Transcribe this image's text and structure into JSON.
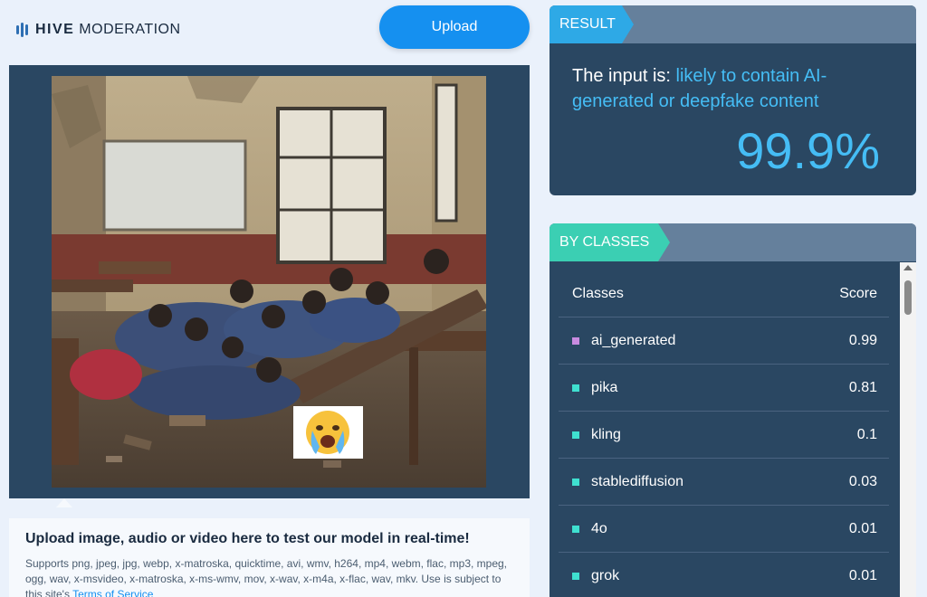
{
  "header": {
    "brand_bold": "HIVE",
    "brand_light": "MODERATION",
    "upload_label": "Upload"
  },
  "upload_info": {
    "title": "Upload image, audio or video here to test our model in real-time!",
    "formats": "Supports png, jpeg, jpg, webp, x-matroska, quicktime, avi, wmv, h264, mp4, webm, flac, mp3, mpeg, ogg, wav, x-msvideo, x-matroska, x-ms-wmv, mov, x-wav, x-m4a, x-flac, wav, mkv. Use is subject to this site's",
    "terms_link": "Terms of Service"
  },
  "result": {
    "tag": "RESULT",
    "prefix": "The input is: ",
    "verdict": "likely to contain AI-generated or deepfake content",
    "score": "99.9%"
  },
  "classes": {
    "tag": "BY CLASSES",
    "col_classes": "Classes",
    "col_score": "Score",
    "rows": [
      {
        "name": "ai_generated",
        "score": "0.99",
        "color": "#c88be0"
      },
      {
        "name": "pika",
        "score": "0.81",
        "color": "#3fe0d0"
      },
      {
        "name": "kling",
        "score": "0.1",
        "color": "#3fe0d0"
      },
      {
        "name": "stablediffusion",
        "score": "0.03",
        "color": "#3fe0d0"
      },
      {
        "name": "4o",
        "score": "0.01",
        "color": "#3fe0d0"
      },
      {
        "name": "grok",
        "score": "0.01",
        "color": "#3fe0d0"
      }
    ]
  },
  "colors": {
    "accent_blue": "#1590f0",
    "panel_navy": "#2a4762",
    "highlight": "#45bdf5"
  },
  "icons": {
    "logo": "hive-bars-icon",
    "overlay_emoji": "crying-face-icon"
  }
}
